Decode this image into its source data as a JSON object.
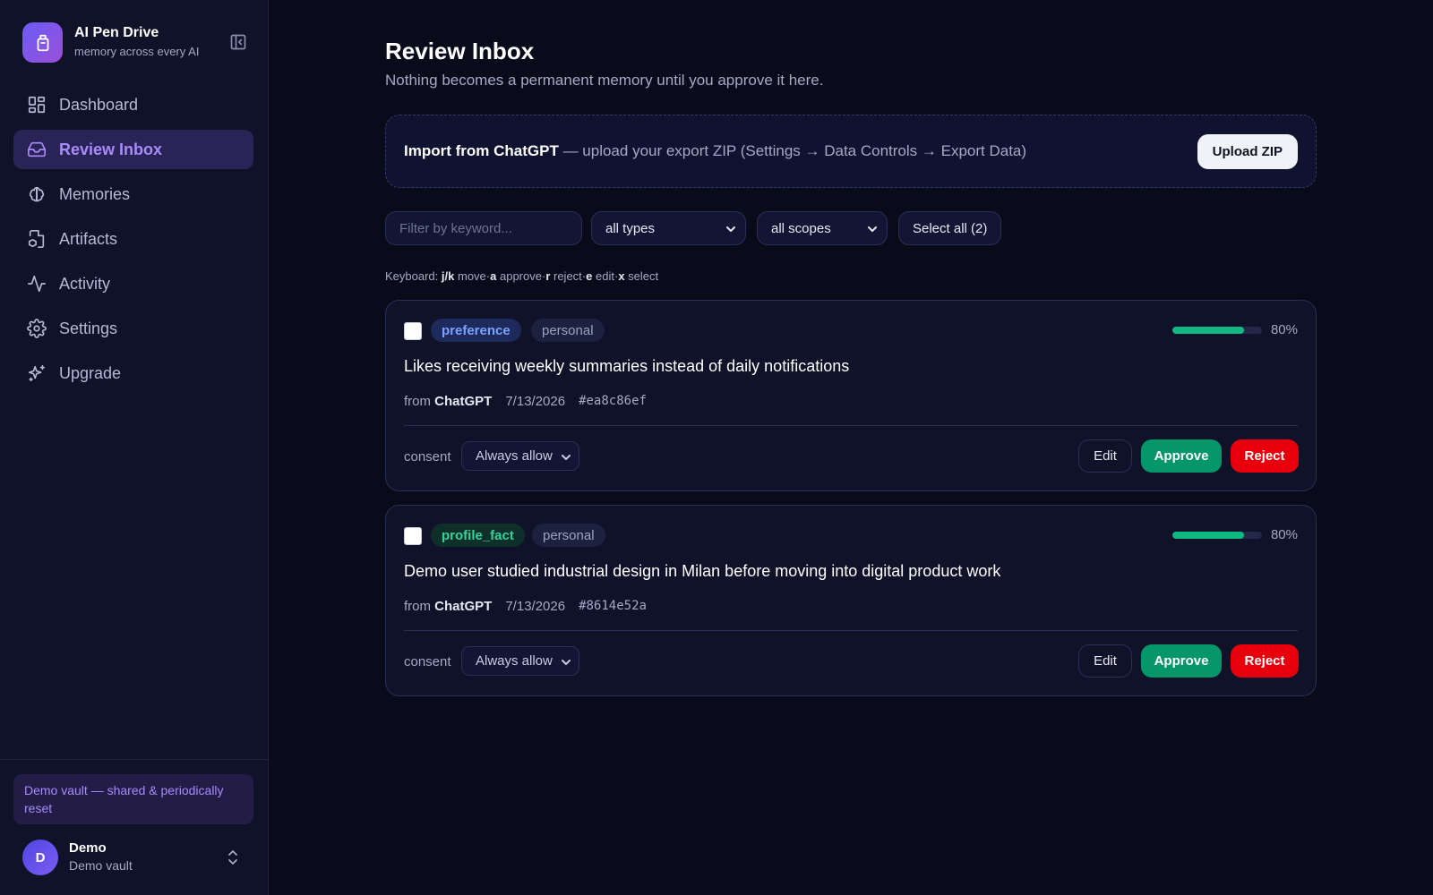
{
  "brand": {
    "title": "AI Pen Drive",
    "subtitle": "memory across every AI"
  },
  "nav": [
    {
      "label": "Dashboard",
      "icon": "dashboard-icon",
      "active": false
    },
    {
      "label": "Review Inbox",
      "icon": "inbox-icon",
      "active": true
    },
    {
      "label": "Memories",
      "icon": "brain-icon",
      "active": false
    },
    {
      "label": "Artifacts",
      "icon": "file-box-icon",
      "active": false
    },
    {
      "label": "Activity",
      "icon": "activity-icon",
      "active": false
    },
    {
      "label": "Settings",
      "icon": "gear-icon",
      "active": false
    },
    {
      "label": "Upgrade",
      "icon": "sparkles-icon",
      "active": false
    }
  ],
  "demo_banner": "Demo vault — shared & periodically reset",
  "user": {
    "initial": "D",
    "name": "Demo",
    "vault": "Demo vault"
  },
  "page": {
    "title": "Review Inbox",
    "subtitle": "Nothing becomes a permanent memory until you approve it here."
  },
  "import": {
    "title": "Import from ChatGPT",
    "description": " — upload your export ZIP (Settings → Data Controls → Export Data)",
    "button": "Upload ZIP"
  },
  "filters": {
    "keyword_placeholder": "Filter by keyword...",
    "type_selected": "all types",
    "scope_selected": "all scopes",
    "select_all": "Select all (2)"
  },
  "keyboard": {
    "prefix": "Keyboard:",
    "keys": [
      {
        "key": "j/k",
        "action": "move"
      },
      {
        "key": "a",
        "action": "approve"
      },
      {
        "key": "r",
        "action": "reject"
      },
      {
        "key": "e",
        "action": "edit"
      },
      {
        "key": "x",
        "action": "select"
      }
    ]
  },
  "colors": {
    "accent": "#a78bfa",
    "approve": "#059669",
    "reject": "#e7000b",
    "confidence": "#10b981",
    "tag_preference_bg": "#1e2a5c",
    "tag_preference_fg": "#7aa2ff",
    "tag_profile_bg": "#0f2f2a",
    "tag_profile_fg": "#34d399"
  },
  "cards": [
    {
      "type": "preference",
      "scope": "personal",
      "confidence": 0.8,
      "confidence_label": "80%",
      "text": "Likes receiving weekly summaries instead of daily notifications",
      "from_prefix": "from",
      "source": "ChatGPT",
      "date": "7/13/2026",
      "hash": "#ea8c86ef",
      "consent_label": "consent",
      "consent_value": "Always allow",
      "edit": "Edit",
      "approve": "Approve",
      "reject": "Reject"
    },
    {
      "type": "profile_fact",
      "scope": "personal",
      "confidence": 0.8,
      "confidence_label": "80%",
      "text": "Demo user studied industrial design in Milan before moving into digital product work",
      "from_prefix": "from",
      "source": "ChatGPT",
      "date": "7/13/2026",
      "hash": "#8614e52a",
      "consent_label": "consent",
      "consent_value": "Always allow",
      "edit": "Edit",
      "approve": "Approve",
      "reject": "Reject"
    }
  ]
}
